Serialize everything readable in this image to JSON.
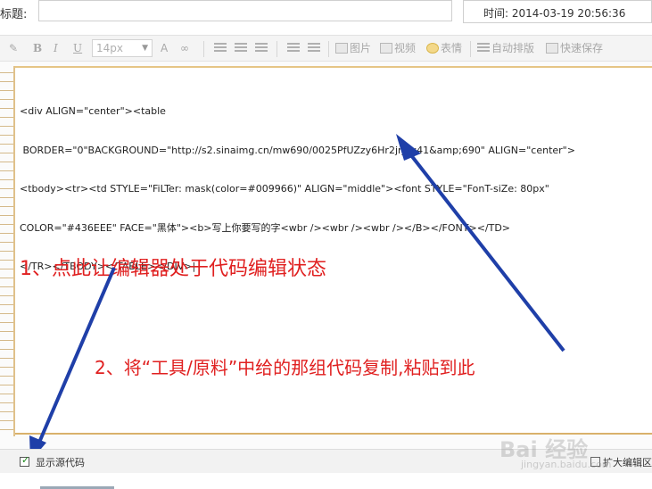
{
  "header": {
    "title_label": "标题:",
    "title_value": "",
    "time_label": "时间:",
    "time_value": "2014-03-19 20:56:36"
  },
  "toolbar": {
    "bold": "B",
    "italic": "I",
    "underline": "U",
    "font_size": "14px",
    "image_label": "图片",
    "video_label": "视频",
    "emoji_label": "表情",
    "auto_layout_label": "自动排版",
    "quick_save_label": "快速保存"
  },
  "editor": {
    "code_lines": [
      "<div ALIGN=\"center\"><table",
      " BORDER=\"0\"BACKGROUND=\"http://s2.sinaimg.cn/mw690/0025PfUZzy6Hr2jrj2x41&amp;690\" ALIGN=\"center\">",
      "<tbody><tr><td STYLE=\"FiLTer: mask(color=#009966)\" ALIGN=\"middle\"><font STYLE=\"FonT-siZe: 80px\"",
      "COLOR=\"#436EEE\" FACE=\"黑体\"><b>写上你要写的字<wbr /><wbr /><wbr /></B></FONT></TD>",
      "</TR></TBODY></TABLE></DIV>|"
    ]
  },
  "annotations": {
    "note1": "1、点此让编辑器处于代码编辑状态",
    "note2": "2、将“工具/原料”中给的那组代码复制,粘贴到此",
    "arrow_color": "#1f3fa8",
    "text_color": "#e02020"
  },
  "footer": {
    "show_source_label": "显示源代码",
    "show_source_checked": true,
    "expand_label": "扩大编辑区"
  },
  "watermark": {
    "text": "Bai 经验",
    "sub": "jingyan.baidu.com"
  }
}
